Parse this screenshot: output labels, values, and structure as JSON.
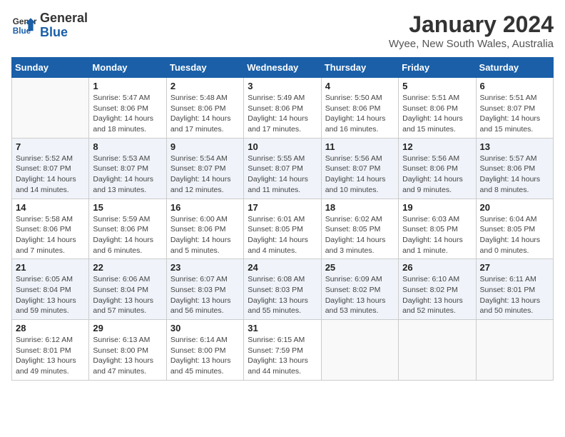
{
  "logo": {
    "text_general": "General",
    "text_blue": "Blue"
  },
  "title": "January 2024",
  "subtitle": "Wyee, New South Wales, Australia",
  "headers": [
    "Sunday",
    "Monday",
    "Tuesday",
    "Wednesday",
    "Thursday",
    "Friday",
    "Saturday"
  ],
  "weeks": [
    {
      "shaded": false,
      "days": [
        {
          "number": "",
          "info": ""
        },
        {
          "number": "1",
          "info": "Sunrise: 5:47 AM\nSunset: 8:06 PM\nDaylight: 14 hours\nand 18 minutes."
        },
        {
          "number": "2",
          "info": "Sunrise: 5:48 AM\nSunset: 8:06 PM\nDaylight: 14 hours\nand 17 minutes."
        },
        {
          "number": "3",
          "info": "Sunrise: 5:49 AM\nSunset: 8:06 PM\nDaylight: 14 hours\nand 17 minutes."
        },
        {
          "number": "4",
          "info": "Sunrise: 5:50 AM\nSunset: 8:06 PM\nDaylight: 14 hours\nand 16 minutes."
        },
        {
          "number": "5",
          "info": "Sunrise: 5:51 AM\nSunset: 8:06 PM\nDaylight: 14 hours\nand 15 minutes."
        },
        {
          "number": "6",
          "info": "Sunrise: 5:51 AM\nSunset: 8:07 PM\nDaylight: 14 hours\nand 15 minutes."
        }
      ]
    },
    {
      "shaded": true,
      "days": [
        {
          "number": "7",
          "info": "Sunrise: 5:52 AM\nSunset: 8:07 PM\nDaylight: 14 hours\nand 14 minutes."
        },
        {
          "number": "8",
          "info": "Sunrise: 5:53 AM\nSunset: 8:07 PM\nDaylight: 14 hours\nand 13 minutes."
        },
        {
          "number": "9",
          "info": "Sunrise: 5:54 AM\nSunset: 8:07 PM\nDaylight: 14 hours\nand 12 minutes."
        },
        {
          "number": "10",
          "info": "Sunrise: 5:55 AM\nSunset: 8:07 PM\nDaylight: 14 hours\nand 11 minutes."
        },
        {
          "number": "11",
          "info": "Sunrise: 5:56 AM\nSunset: 8:07 PM\nDaylight: 14 hours\nand 10 minutes."
        },
        {
          "number": "12",
          "info": "Sunrise: 5:56 AM\nSunset: 8:06 PM\nDaylight: 14 hours\nand 9 minutes."
        },
        {
          "number": "13",
          "info": "Sunrise: 5:57 AM\nSunset: 8:06 PM\nDaylight: 14 hours\nand 8 minutes."
        }
      ]
    },
    {
      "shaded": false,
      "days": [
        {
          "number": "14",
          "info": "Sunrise: 5:58 AM\nSunset: 8:06 PM\nDaylight: 14 hours\nand 7 minutes."
        },
        {
          "number": "15",
          "info": "Sunrise: 5:59 AM\nSunset: 8:06 PM\nDaylight: 14 hours\nand 6 minutes."
        },
        {
          "number": "16",
          "info": "Sunrise: 6:00 AM\nSunset: 8:06 PM\nDaylight: 14 hours\nand 5 minutes."
        },
        {
          "number": "17",
          "info": "Sunrise: 6:01 AM\nSunset: 8:05 PM\nDaylight: 14 hours\nand 4 minutes."
        },
        {
          "number": "18",
          "info": "Sunrise: 6:02 AM\nSunset: 8:05 PM\nDaylight: 14 hours\nand 3 minutes."
        },
        {
          "number": "19",
          "info": "Sunrise: 6:03 AM\nSunset: 8:05 PM\nDaylight: 14 hours\nand 1 minute."
        },
        {
          "number": "20",
          "info": "Sunrise: 6:04 AM\nSunset: 8:05 PM\nDaylight: 14 hours\nand 0 minutes."
        }
      ]
    },
    {
      "shaded": true,
      "days": [
        {
          "number": "21",
          "info": "Sunrise: 6:05 AM\nSunset: 8:04 PM\nDaylight: 13 hours\nand 59 minutes."
        },
        {
          "number": "22",
          "info": "Sunrise: 6:06 AM\nSunset: 8:04 PM\nDaylight: 13 hours\nand 57 minutes."
        },
        {
          "number": "23",
          "info": "Sunrise: 6:07 AM\nSunset: 8:03 PM\nDaylight: 13 hours\nand 56 minutes."
        },
        {
          "number": "24",
          "info": "Sunrise: 6:08 AM\nSunset: 8:03 PM\nDaylight: 13 hours\nand 55 minutes."
        },
        {
          "number": "25",
          "info": "Sunrise: 6:09 AM\nSunset: 8:02 PM\nDaylight: 13 hours\nand 53 minutes."
        },
        {
          "number": "26",
          "info": "Sunrise: 6:10 AM\nSunset: 8:02 PM\nDaylight: 13 hours\nand 52 minutes."
        },
        {
          "number": "27",
          "info": "Sunrise: 6:11 AM\nSunset: 8:01 PM\nDaylight: 13 hours\nand 50 minutes."
        }
      ]
    },
    {
      "shaded": false,
      "days": [
        {
          "number": "28",
          "info": "Sunrise: 6:12 AM\nSunset: 8:01 PM\nDaylight: 13 hours\nand 49 minutes."
        },
        {
          "number": "29",
          "info": "Sunrise: 6:13 AM\nSunset: 8:00 PM\nDaylight: 13 hours\nand 47 minutes."
        },
        {
          "number": "30",
          "info": "Sunrise: 6:14 AM\nSunset: 8:00 PM\nDaylight: 13 hours\nand 45 minutes."
        },
        {
          "number": "31",
          "info": "Sunrise: 6:15 AM\nSunset: 7:59 PM\nDaylight: 13 hours\nand 44 minutes."
        },
        {
          "number": "",
          "info": ""
        },
        {
          "number": "",
          "info": ""
        },
        {
          "number": "",
          "info": ""
        }
      ]
    }
  ]
}
